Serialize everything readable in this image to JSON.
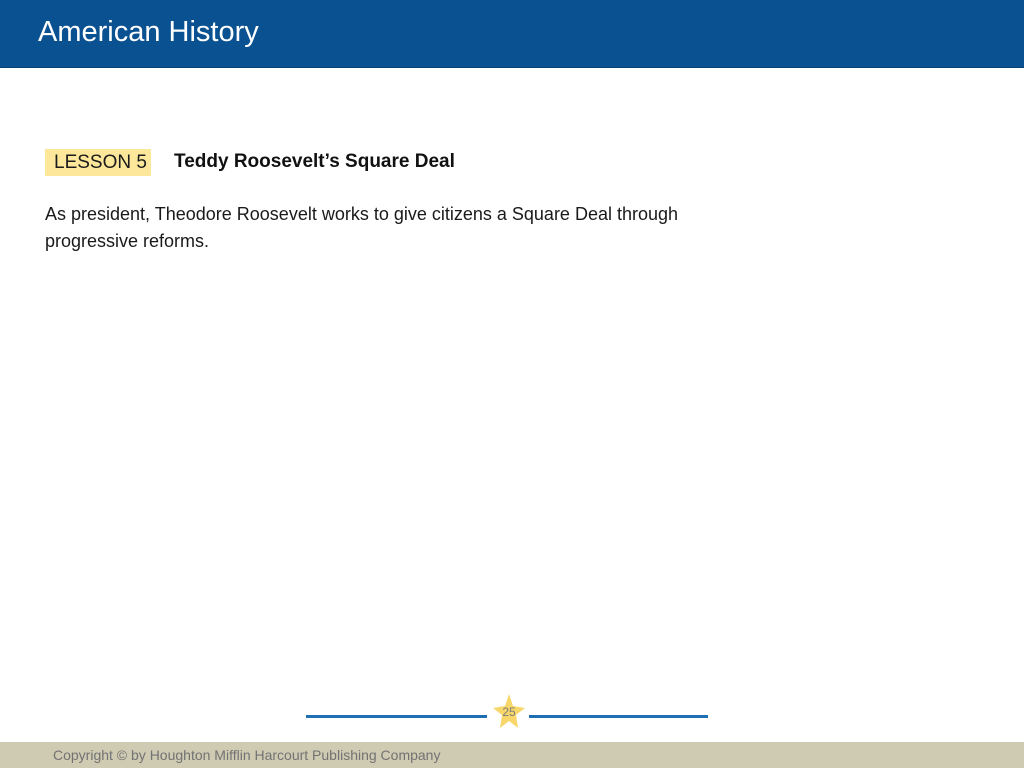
{
  "header": {
    "title": "American History"
  },
  "lesson": {
    "badge": "LESSON 5",
    "title": "Teddy Roosevelt’s Square Deal",
    "summary": "As president, Theodore Roosevelt works to give citizens a Square Deal through progressive reforms."
  },
  "page_marker": {
    "page_number": "25",
    "icon": "star-icon"
  },
  "footer": {
    "copyright": "Copyright © by Houghton Mifflin Harcourt Publishing Company"
  },
  "colors": {
    "header_blue": "#0a5192",
    "lesson_badge_yellow": "#fde79a",
    "divider_blue": "#1f6fb4",
    "star_yellow": "#f7d66a",
    "footer_tan": "#cfcbb3"
  }
}
